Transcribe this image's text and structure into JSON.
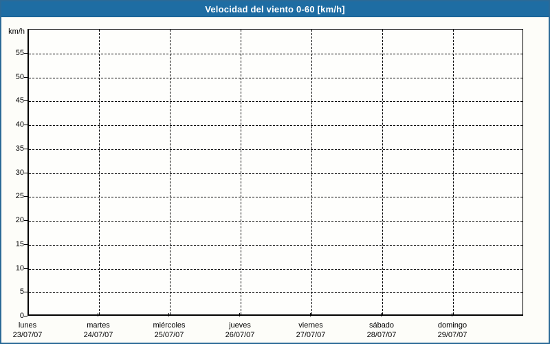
{
  "window": {
    "title": "Velocidad del viento 0-60 [km/h]"
  },
  "colors": {
    "title_bar_bg": "#1e6da3",
    "title_text": "#ffffff",
    "frame_border": "#2b6a97",
    "background": "#fdfdf9",
    "plot_border": "#000000",
    "gridline": "#000000",
    "tick_text": "#000000"
  },
  "chart_data": {
    "type": "line",
    "title": "Velocidad del viento 0-60 [km/h]",
    "ylabel": "km/h",
    "ylim": [
      0,
      60
    ],
    "yticks": [
      0,
      5,
      10,
      15,
      20,
      25,
      30,
      35,
      40,
      45,
      50,
      55
    ],
    "grid": "dashed, both axes",
    "legend": "none",
    "x_categories": [
      {
        "day": "lunes",
        "date": "23/07/07"
      },
      {
        "day": "martes",
        "date": "24/07/07"
      },
      {
        "day": "miércoles",
        "date": "25/07/07"
      },
      {
        "day": "jueves",
        "date": "26/07/07"
      },
      {
        "day": "viernes",
        "date": "27/07/07"
      },
      {
        "day": "sábado",
        "date": "28/07/07"
      },
      {
        "day": "domingo",
        "date": "29/07/07"
      }
    ],
    "series": []
  }
}
